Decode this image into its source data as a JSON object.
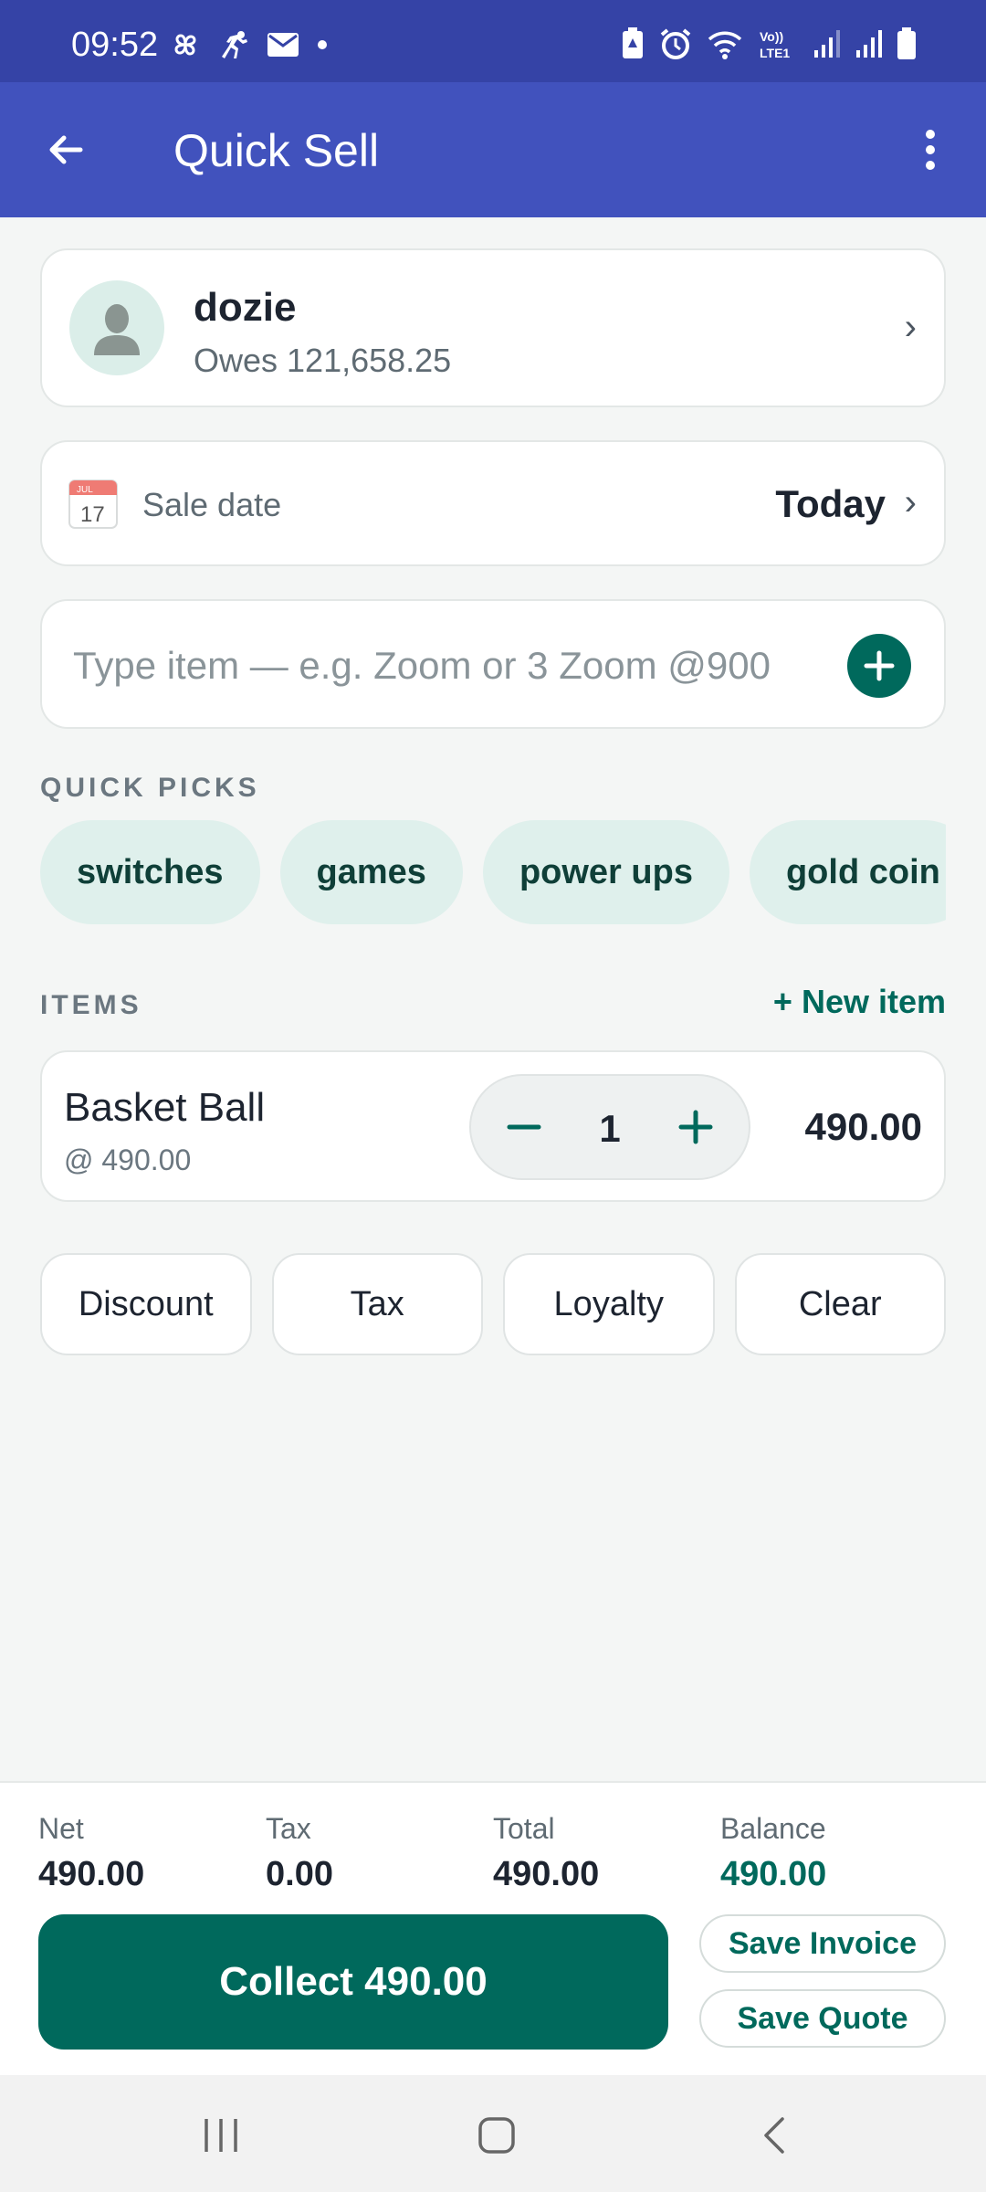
{
  "status_bar": {
    "time": "09:52",
    "left_icons": [
      "pinwheel-icon",
      "running-icon",
      "mail-icon",
      "dot-icon"
    ],
    "right_icons": [
      "battery-saver-icon",
      "alarm-icon",
      "wifi-icon",
      "volte-icon",
      "signal-icon",
      "signal-icon",
      "battery-icon"
    ],
    "network_label": "Vo)) LTE1"
  },
  "app_bar": {
    "title": "Quick Sell",
    "back_icon": "arrow-left-icon",
    "menu_icon": "more-vert-icon"
  },
  "customer": {
    "name": "dozie",
    "owes": "Owes 121,658.25"
  },
  "sale_date": {
    "label": "Sale date",
    "value": "Today",
    "calendar_month": "JUL",
    "calendar_day": "17"
  },
  "entry": {
    "placeholder": "Type item — e.g. Zoom or 3 Zoom @900",
    "value": ""
  },
  "quick_picks": {
    "label": "QUICK PICKS",
    "chips": [
      "switches",
      "games",
      "power ups",
      "gold coin"
    ]
  },
  "items": {
    "label": "ITEMS",
    "new_item": "+ New item",
    "list": [
      {
        "name": "Basket Ball",
        "unit_price": "@ 490.00",
        "qty": "1",
        "total": "490.00"
      }
    ]
  },
  "actions": [
    "Discount",
    "Tax",
    "Loyalty",
    "Clear"
  ],
  "summary": {
    "net_label": "Net",
    "net": "490.00",
    "tax_label": "Tax",
    "tax": "0.00",
    "total_label": "Total",
    "total": "490.00",
    "balance_label": "Balance",
    "balance": "490.00"
  },
  "buttons": {
    "collect": "Collect 490.00",
    "save_invoice": "Save Invoice",
    "save_quote": "Save Quote"
  },
  "colors": {
    "status_bar": "#3543a6",
    "app_bar": "#4152bd",
    "accent": "#00695c",
    "chip_bg": "#dff0ec"
  }
}
